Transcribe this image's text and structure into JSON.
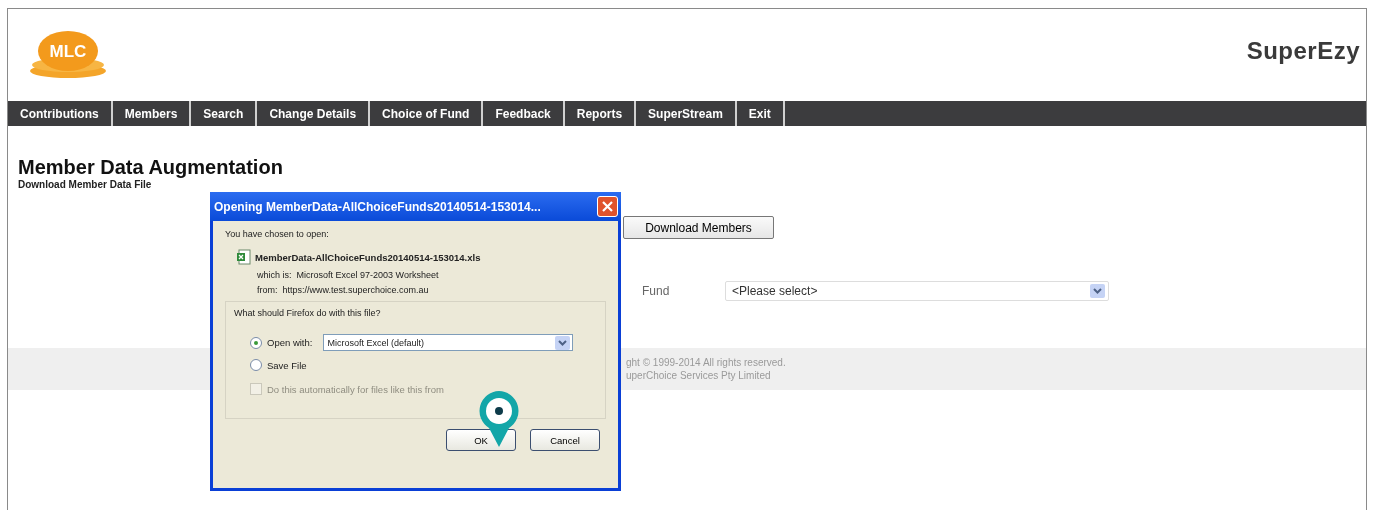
{
  "header": {
    "logo_text": "MLC",
    "brand": "SuperEzy"
  },
  "nav": [
    "Contributions",
    "Members",
    "Search",
    "Change Details",
    "Choice of Fund",
    "Feedback",
    "Reports",
    "SuperStream",
    "Exit"
  ],
  "page": {
    "title": "Member Data Augmentation",
    "subtitle": "Download Member Data File",
    "download_button": "Download Members",
    "fund_label": "Fund",
    "fund_select": "<Please select>"
  },
  "footer": [
    "ght © 1999-2014 All rights reserved.",
    "uperChoice Services Pty Limited"
  ],
  "dialog": {
    "title": "Opening MemberData-AllChoiceFunds20140514-153014...",
    "intro": "You have chosen to open:",
    "filename": "MemberData-AllChoiceFunds20140514-153014.xls",
    "which_label": "which is:",
    "which_value": "Microsoft Excel 97-2003 Worksheet",
    "from_label": "from:",
    "from_value": "https://www.test.superchoice.com.au",
    "question": "What should Firefox do with this file?",
    "options": [
      {
        "label": "Open with:",
        "selected": true
      },
      {
        "label": "Save File",
        "selected": false
      }
    ],
    "app_select": "Microsoft Excel (default)",
    "auto_checkbox": {
      "label": "Do this automatically for files like this from",
      "checked": false,
      "disabled": true
    },
    "buttons": [
      "OK",
      "Cancel"
    ]
  }
}
